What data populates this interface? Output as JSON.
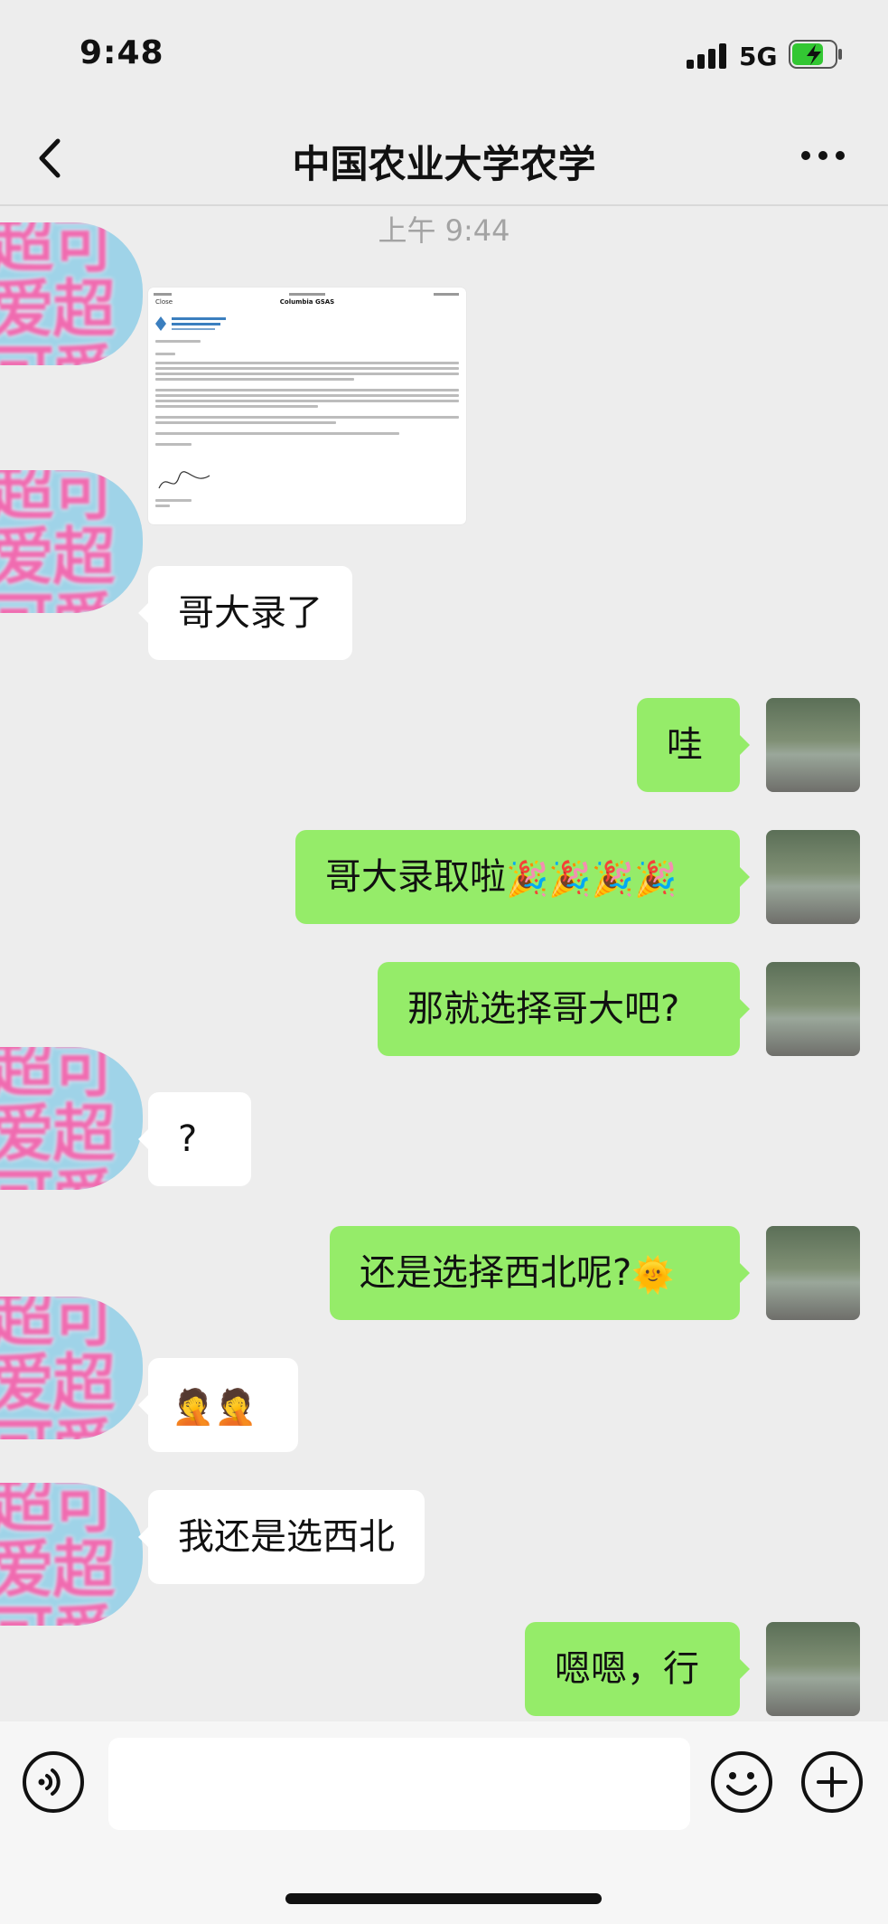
{
  "status_bar": {
    "time": "9:48",
    "network": "5G",
    "battery_color": "#33c733"
  },
  "nav": {
    "title": "中国农业大学农学",
    "back_icon": "chevron-left-icon",
    "more_icon": "more-dots-icon"
  },
  "chat": {
    "timestamp": "上午 9:44",
    "avatar_left_text": "超可爱超可爱超可爱超可",
    "document": {
      "close": "Close",
      "title": "Columbia GSAS",
      "logo": "GRADUATE SCHOOL OF ARTS AND SCIENCES COLUMBIA UNIVERSITY"
    },
    "messages": [
      {
        "side": "in",
        "text": "哥大录了"
      },
      {
        "side": "out",
        "text": "哇"
      },
      {
        "side": "out",
        "text": "哥大录取啦",
        "emoji": "🎉🎉🎉🎉"
      },
      {
        "side": "out",
        "text": "那就选择哥大吧?"
      },
      {
        "side": "in",
        "text": "?"
      },
      {
        "side": "out",
        "text": "还是选择西北呢?",
        "emoji": "🌞"
      },
      {
        "side": "in",
        "text": "",
        "emoji": "🤦🤦"
      },
      {
        "side": "in",
        "text": "我还是选西北"
      },
      {
        "side": "out",
        "text": "嗯嗯，行"
      }
    ],
    "colors": {
      "outgoing": "#95ec69",
      "incoming": "#ffffff",
      "background": "#ededed"
    }
  },
  "input_bar": {
    "voice_icon": "voice-icon",
    "input_placeholder": "",
    "emoji_icon": "smiley-icon",
    "plus_icon": "plus-icon"
  }
}
